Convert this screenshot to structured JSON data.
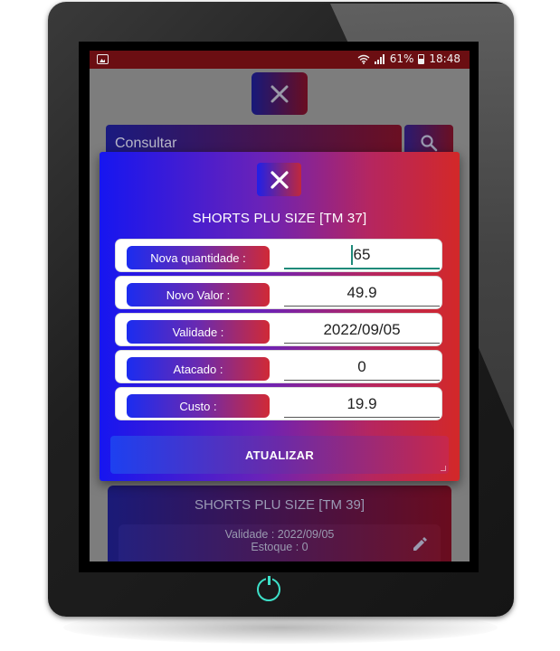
{
  "status_bar": {
    "battery": "61%",
    "time": "18:48"
  },
  "background": {
    "search_placeholder": "Consultar",
    "card": {
      "title": "SHORTS PLU SIZE [TM 39]",
      "validade": "Validade : 2022/09/05",
      "estoque": "Estoque  : 0"
    }
  },
  "dialog": {
    "title": "SHORTS PLU SIZE [TM 37]",
    "fields": [
      {
        "label": "Nova quantidade :",
        "value": "65"
      },
      {
        "label": "Novo Valor :",
        "value": "49.9"
      },
      {
        "label": "Validade :",
        "value": "2022/09/05"
      },
      {
        "label": "Atacado :",
        "value": "0"
      },
      {
        "label": "Custo :",
        "value": "19.9"
      }
    ],
    "update_button": "ATUALIZAR"
  },
  "icons": [
    "gallery-icon",
    "wifi-icon",
    "signal-icon",
    "battery-icon",
    "close-icon",
    "search-icon",
    "pencil-icon",
    "power-icon"
  ],
  "colors": {
    "status_bar": "#6b0e12",
    "gradient_start": "#1616f0",
    "gradient_end": "#d32828",
    "focus_underline": "#1f8a7a"
  }
}
